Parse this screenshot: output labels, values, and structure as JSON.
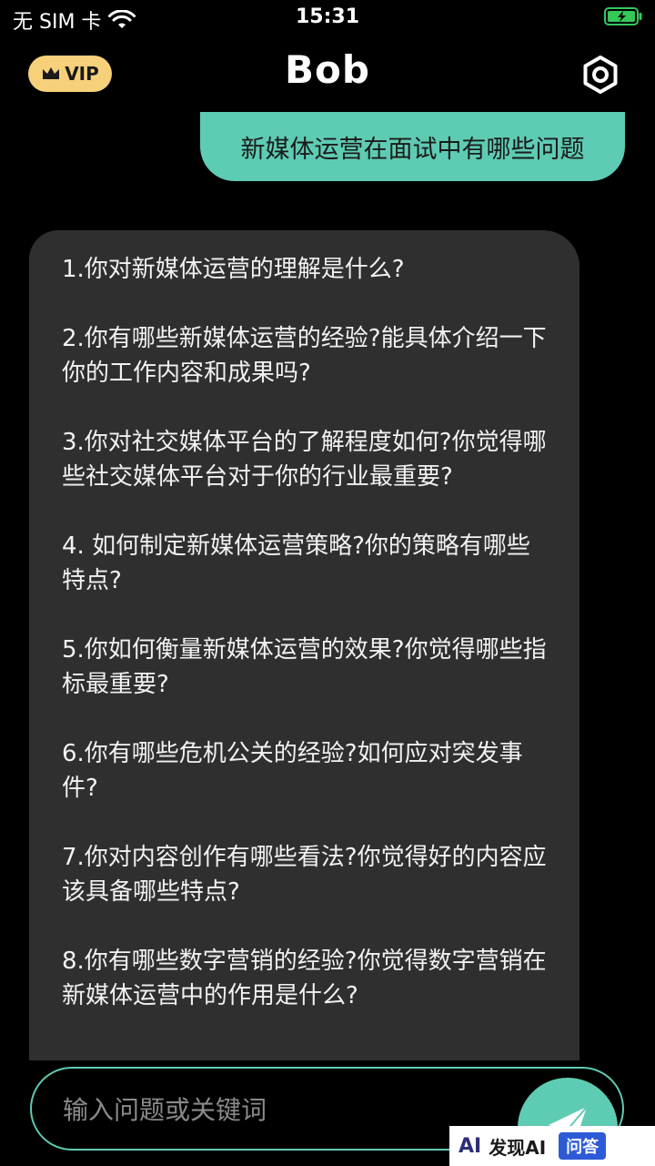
{
  "status_bar": {
    "carrier": "无 SIM 卡",
    "time": "15:31"
  },
  "header": {
    "vip_label": "VIP",
    "title": "Bob"
  },
  "user_message": "新媒体运营在面试中有哪些问题",
  "bot_message": {
    "items": [
      "1.你对新媒体运营的理解是什么?",
      "2.你有哪些新媒体运营的经验?能具体介绍一下你的工作内容和成果吗?",
      "3.你对社交媒体平台的了解程度如何?你觉得哪些社交媒体平台对于你的行业最重要?",
      "4. 如何制定新媒体运营策略?你的策略有哪些特点?",
      "5.你如何衡量新媒体运营的效果?你觉得哪些指标最重要?",
      "6.你有哪些危机公关的经验?如何应对突发事件?",
      "7.你对内容创作有哪些看法?你觉得好的内容应该具备哪些特点?",
      "8.你有哪些数字营销的经验?你觉得数字营销在新媒体运营中的作用是什么?"
    ]
  },
  "input": {
    "placeholder": "输入问题或关键词"
  },
  "watermark": {
    "logo": "AI",
    "name": "发现AI",
    "tag": "问答"
  },
  "colors": {
    "accent": "#5ecbb3",
    "vip": "#f7d07a",
    "bubble_bg": "#2f2f2f",
    "battery": "#34c759"
  },
  "icons": [
    "crown-icon",
    "wifi-icon",
    "battery-icon",
    "settings-icon",
    "send-icon"
  ]
}
